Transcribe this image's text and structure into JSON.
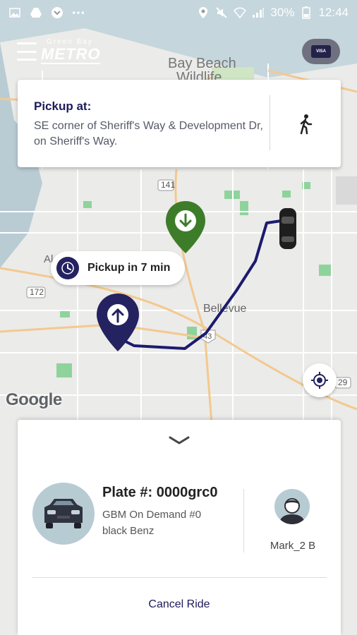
{
  "status_bar": {
    "battery": "30%",
    "time": "12:44",
    "icons_left": [
      "image-icon",
      "drive-icon",
      "app-icon",
      "more-dots-icon"
    ],
    "icons_right": [
      "location-icon",
      "mute-icon",
      "wifi-icon",
      "signal-icon",
      "battery-icon"
    ]
  },
  "header": {
    "logo_small": "Green Bay",
    "logo_big": "METRO",
    "payment_card_label": "VISA"
  },
  "map": {
    "labels": {
      "place1": "Bay Beach",
      "place2": "Wildlife",
      "bellevue": "Bellevue",
      "route_141": "141",
      "route_172": "172",
      "route_43": "43",
      "route_29": "29",
      "al": "Al"
    },
    "attribution": "Google",
    "colors": {
      "route": "#1c1a6e",
      "pickup_pin": "#242260",
      "dropoff_pin": "#3d7d2a"
    }
  },
  "pickup_card": {
    "title": "Pickup at:",
    "address": "SE corner of Sheriff's Way & Development Dr, on Sheriff's Way."
  },
  "eta_bubble": {
    "text": "Pickup in 7 min"
  },
  "ride_panel": {
    "plate": "Plate #: 0000grc0",
    "vehicle_name": "GBM On Demand #0",
    "vehicle_desc": "black Benz",
    "driver_name": "Mark_2 B",
    "cancel_label": "Cancel Ride"
  }
}
